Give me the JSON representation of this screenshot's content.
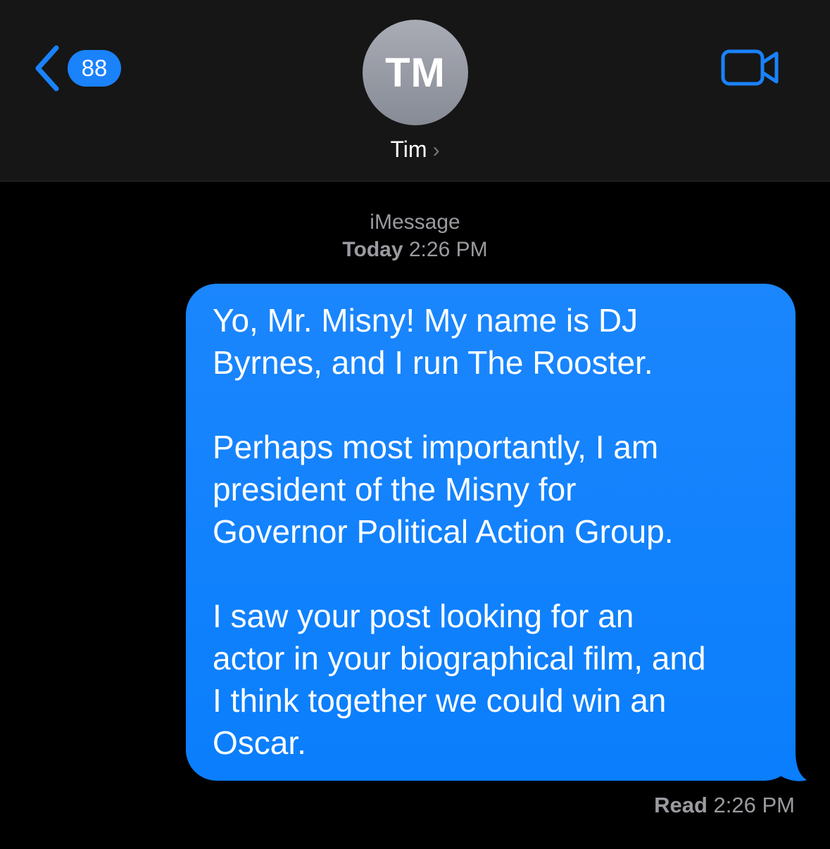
{
  "nav": {
    "back_count": "88",
    "back_icon": "chevron-left-icon",
    "video_icon": "video-camera-icon"
  },
  "contact": {
    "initials": "TM",
    "name": "Tim",
    "chevron": "›"
  },
  "thread": {
    "service": "iMessage",
    "date_label": "Today",
    "date_time": "2:26 PM"
  },
  "message": {
    "paragraphs": [
      [
        "Yo, Mr. Misny! My name is DJ",
        "Byrnes, and I run The Rooster."
      ],
      [
        "Perhaps most importantly, I am",
        "president of the Misny for",
        "Governor Political Action Group."
      ],
      [
        "I saw your post looking for an",
        "actor in your biographical film, and",
        "I think together we could win an",
        "Oscar."
      ]
    ],
    "status_label": "Read",
    "status_time": "2:26 PM"
  },
  "colors": {
    "accent": "#1a82fb",
    "bubble": "#0a7efc",
    "header_bg": "#161616",
    "secondary_text": "#9a9aa0"
  }
}
